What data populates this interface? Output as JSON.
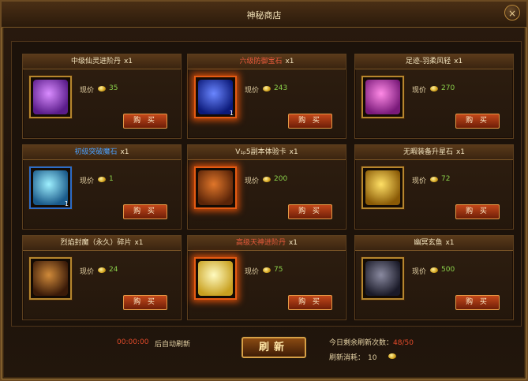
{
  "window": {
    "title": "神秘商店",
    "close_symbol": "×"
  },
  "labels": {
    "price": "现价",
    "buy": "购 买"
  },
  "items": [
    {
      "name": "中级仙灵进阶丹",
      "name_color": "#f3e5c0",
      "qty": "x1",
      "price": "35",
      "stack": "",
      "frame": "gold",
      "icon": "purple-orb-icon",
      "icon_colors": [
        "#d98cff",
        "#5a1c8a"
      ]
    },
    {
      "name": "六级防御宝石",
      "name_color": "#e85a3c",
      "qty": "x1",
      "price": "243",
      "stack": "1",
      "frame": "red",
      "icon": "blue-gem-icon",
      "icon_colors": [
        "#6a86ff",
        "#0c1a7a"
      ]
    },
    {
      "name": "足迹-羽柔风轻",
      "name_color": "#f3e5c0",
      "qty": "x1",
      "price": "270",
      "stack": "",
      "frame": "gold",
      "icon": "feather-icon",
      "icon_colors": [
        "#ff8ae6",
        "#7a1a7a"
      ]
    },
    {
      "name": "初级突破魔石",
      "name_color": "#4aa0ff",
      "qty": "x1",
      "price": "1",
      "stack": "1",
      "frame": "blue",
      "icon": "crystal-icon",
      "icon_colors": [
        "#9ef0ff",
        "#1a5a8a"
      ]
    },
    {
      "name": "V₁ₚ5副本体验卡",
      "name_color": "#f3e5c0",
      "qty": "x1",
      "price": "200",
      "stack": "",
      "frame": "red",
      "icon": "vip-card-icon",
      "icon_colors": [
        "#e0762a",
        "#5a2408"
      ]
    },
    {
      "name": "无暇装备升星石",
      "name_color": "#f3e5c0",
      "qty": "x1",
      "price": "72",
      "stack": "",
      "frame": "gold",
      "icon": "gold-stone-icon",
      "icon_colors": [
        "#ffe066",
        "#8a5a06"
      ]
    },
    {
      "name": "烈焰封魔（永久）碎片",
      "name_color": "#f3e5c0",
      "qty": "x1",
      "price": "24",
      "stack": "",
      "frame": "gold",
      "icon": "demon-shard-icon",
      "icon_colors": [
        "#d08a3a",
        "#3a1a08"
      ]
    },
    {
      "name": "高级天神进阶丹",
      "name_color": "#e85a3c",
      "qty": "x1",
      "price": "75",
      "stack": "",
      "frame": "red",
      "icon": "divine-orb-icon",
      "icon_colors": [
        "#fffbc0",
        "#c8a020"
      ]
    },
    {
      "name": "幽冥玄鱼",
      "name_color": "#f3e5c0",
      "qty": "x1",
      "price": "500",
      "stack": "",
      "frame": "gold",
      "icon": "dark-fish-icon",
      "icon_colors": [
        "#8a8aa0",
        "#1a1a28"
      ]
    }
  ],
  "footer": {
    "timer": "00:00:00",
    "auto_refresh_text": "后自动刷新",
    "refresh_button": "刷新",
    "remaining_label": "今日剩余刷新次数：",
    "remaining_value": "48/50",
    "cost_label": "刷新消耗：",
    "cost_value": "10"
  }
}
